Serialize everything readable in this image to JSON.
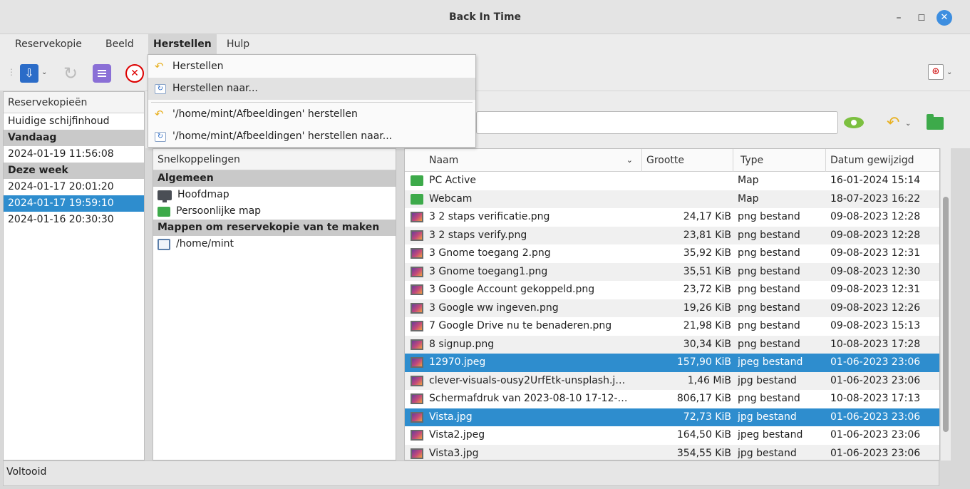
{
  "window": {
    "title": "Back In Time"
  },
  "menubar": {
    "items": [
      "Reservekopie",
      "Beeld",
      "Herstellen",
      "Hulp"
    ]
  },
  "restore_menu": {
    "items": [
      {
        "label": "Herstellen",
        "icon": "restore-icon"
      },
      {
        "label": "Herstellen naar...",
        "icon": "restore-to-icon"
      },
      {
        "label": "'/home/mint/Afbeeldingen' herstellen",
        "icon": "restore-icon"
      },
      {
        "label": "'/home/mint/Afbeeldingen' herstellen naar...",
        "icon": "restore-to-icon"
      }
    ]
  },
  "snapshots": {
    "header": "Reservekopieën",
    "rows": [
      {
        "label": "Huidige schijfinhoud",
        "kind": "item"
      },
      {
        "label": "Vandaag",
        "kind": "group"
      },
      {
        "label": "2024-01-19 11:56:08",
        "kind": "item"
      },
      {
        "label": "Deze week",
        "kind": "group"
      },
      {
        "label": "2024-01-17 20:01:20",
        "kind": "item"
      },
      {
        "label": "2024-01-17 19:59:10",
        "kind": "selected"
      },
      {
        "label": "2024-01-16 20:30:30",
        "kind": "item"
      }
    ]
  },
  "shortcuts": {
    "header": "Snelkoppelingen",
    "group_general": "Algemeen",
    "home": "Hoofdmap",
    "personal": "Persoonlijke map",
    "group_backup": "Mappen om reservekopie van te maken",
    "backup_folder": "/home/mint"
  },
  "files": {
    "columns": {
      "name": "Naam",
      "size": "Grootte",
      "type": "Type",
      "date": "Datum gewijzigd"
    },
    "rows": [
      {
        "name": "PC Active",
        "size": "",
        "type": "Map",
        "date": "16-01-2024 15:14",
        "icon": "folder"
      },
      {
        "name": "Webcam",
        "size": "",
        "type": "Map",
        "date": "18-07-2023 16:22",
        "icon": "folder"
      },
      {
        "name": "3 2 staps verificatie.png",
        "size": "24,17 KiB",
        "type": "png bestand",
        "date": "09-08-2023 12:28",
        "icon": "image"
      },
      {
        "name": "3 2 staps verify.png",
        "size": "23,81 KiB",
        "type": "png bestand",
        "date": "09-08-2023 12:28",
        "icon": "image"
      },
      {
        "name": "3 Gnome toegang 2.png",
        "size": "35,92 KiB",
        "type": "png bestand",
        "date": "09-08-2023 12:31",
        "icon": "image"
      },
      {
        "name": "3 Gnome toegang1.png",
        "size": "35,51 KiB",
        "type": "png bestand",
        "date": "09-08-2023 12:30",
        "icon": "image"
      },
      {
        "name": "3 Google Account gekoppeld.png",
        "size": "23,72 KiB",
        "type": "png bestand",
        "date": "09-08-2023 12:31",
        "icon": "image"
      },
      {
        "name": "3 Google ww ingeven.png",
        "size": "19,26 KiB",
        "type": "png bestand",
        "date": "09-08-2023 12:26",
        "icon": "image"
      },
      {
        "name": "7 Google Drive nu te benaderen.png",
        "size": "21,98 KiB",
        "type": "png bestand",
        "date": "09-08-2023 15:13",
        "icon": "image"
      },
      {
        "name": "8 signup.png",
        "size": "30,34 KiB",
        "type": "png bestand",
        "date": "10-08-2023 17:28",
        "icon": "image"
      },
      {
        "name": "12970.jpeg",
        "size": "157,90 KiB",
        "type": "jpeg bestand",
        "date": "01-06-2023 23:06",
        "icon": "image",
        "selected": true
      },
      {
        "name": "clever-visuals-ousy2UrfEtk-unsplash.j…",
        "size": "1,46 MiB",
        "type": "jpg bestand",
        "date": "01-06-2023 23:06",
        "icon": "image"
      },
      {
        "name": "Schermafdruk van 2023-08-10 17-12-…",
        "size": "806,17 KiB",
        "type": "png bestand",
        "date": "10-08-2023 17:13",
        "icon": "image"
      },
      {
        "name": "Vista.jpg",
        "size": "72,73 KiB",
        "type": "jpg bestand",
        "date": "01-06-2023 23:06",
        "icon": "image",
        "selected": true
      },
      {
        "name": "Vista2.jpeg",
        "size": "164,50 KiB",
        "type": "jpeg bestand",
        "date": "01-06-2023 23:06",
        "icon": "image"
      },
      {
        "name": "Vista3.jpg",
        "size": "354,55 KiB",
        "type": "jpg bestand",
        "date": "01-06-2023 23:06",
        "icon": "image"
      }
    ]
  },
  "status": {
    "text": "Voltooid"
  },
  "colors": {
    "selection": "#2e8dce",
    "close_button": "#3d8ee0",
    "folder": "#3daa4a"
  }
}
